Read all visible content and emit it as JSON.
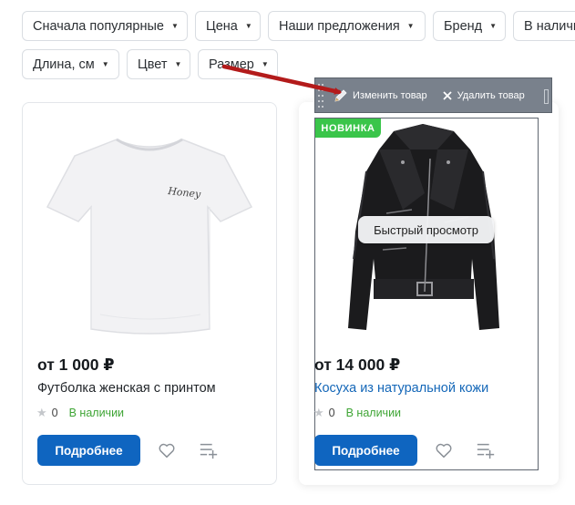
{
  "filters": [
    {
      "label": "Сначала популярные"
    },
    {
      "label": "Цена"
    },
    {
      "label": "Наши предложения"
    },
    {
      "label": "Бренд"
    },
    {
      "label": "В наличи"
    },
    {
      "label": "Длина, см"
    },
    {
      "label": "Цвет"
    },
    {
      "label": "Размер"
    }
  ],
  "toolbar": {
    "edit_label": "Изменить товар",
    "delete_label": "Удалить товар"
  },
  "products": [
    {
      "price": "от 1 000 ₽",
      "title": "Футболка женская с принтом",
      "rating": "0",
      "availability": "В наличии",
      "button_label": "Подробнее",
      "print_text": "Honey"
    },
    {
      "badge": "НОВИНКА",
      "quick_view": "Быстрый просмотр",
      "price": "от 14 000 ₽",
      "title": "Косуха из натуральной кожи",
      "rating": "0",
      "availability": "В наличии",
      "button_label": "Подробнее"
    }
  ],
  "colors": {
    "primary_button": "#0f65c0",
    "link": "#1467b8",
    "in_stock": "#3fa535",
    "badge_new": "#3ac54a",
    "toolbar_bg": "#79818c",
    "annotation_arrow": "#b31b1b"
  },
  "icons": {
    "filter_caret": "caret-down-icon",
    "edit": "pencil-icon",
    "delete": "close-icon",
    "rating": "star-icon",
    "favorite": "heart-icon",
    "compare": "compare-list-icon"
  }
}
